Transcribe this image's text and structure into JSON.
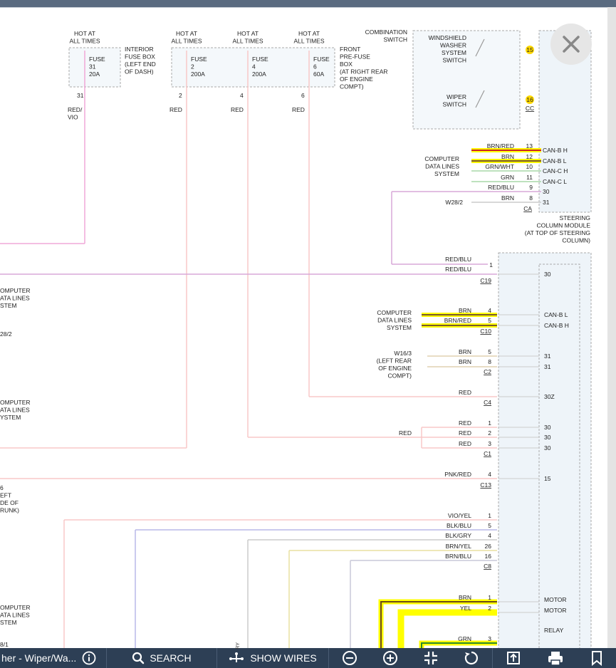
{
  "toolbar": {
    "title": "her - Wiper/Wa...",
    "search_label": "SEARCH",
    "show_wires_label": "SHOW WIRES",
    "vertical_stub": "RY"
  },
  "diagram": {
    "fuses": [
      {
        "hot": "HOT AT\nALL TIMES",
        "fuse": "FUSE\n31\n20A",
        "pin": "31",
        "wire": "RED/\nVIO"
      },
      {
        "hot": "HOT AT\nALL TIMES",
        "fuse": "FUSE\n2\n200A",
        "pin": "2",
        "wire": "RED"
      },
      {
        "hot": "HOT AT\nALL TIMES",
        "fuse": "FUSE\n4\n200A",
        "pin": "4",
        "wire": "RED"
      },
      {
        "hot": "HOT AT\nALL TIMES",
        "fuse": "FUSE\n6\n60A",
        "pin": "6",
        "wire": "RED"
      }
    ],
    "interior_fuse_box": "INTERIOR\nFUSE BOX\n(LEFT END\nOF DASH)",
    "front_prefuse_box": "FRONT\nPRE-FUSE\nBOX\n(AT RIGHT REAR\nOF ENGINE\nCOMPT)",
    "combination_switch": "COMBINATION\nSWITCH",
    "washer_switch": "WINDSHIELD\nWASHER\nSYSTEM\nSWITCH",
    "wiper_switch": "WIPER\nSWITCH",
    "badge_15": "15",
    "badge_16": "16",
    "cc_label": "CC",
    "computer_data_lines": "COMPUTER\nDATA LINES\nSYSTEM",
    "ca_wires": [
      {
        "color": "BRN/RED",
        "pin": "13",
        "signal": "CAN-B H"
      },
      {
        "color": "BRN",
        "pin": "12",
        "signal": "CAN-B L"
      },
      {
        "color": "GRN/WHT",
        "pin": "10",
        "signal": "CAN-C H"
      },
      {
        "color": "GRN",
        "pin": "11",
        "signal": "CAN-C L"
      },
      {
        "color": "RED/BLU",
        "pin": "9",
        "signal": "30"
      },
      {
        "color": "BRN",
        "pin": "8",
        "signal": "31"
      }
    ],
    "w28_2": "W28/2",
    "ca_label": "CA",
    "steering_column_module": "STEERING\nCOLUMN MODULE\n(AT TOP OF STEERING\nCOLUMN)",
    "c19": {
      "wire1": "RED/BLU",
      "wire2": "RED/BLU",
      "pin": "1",
      "conn": "C19",
      "signal": "30"
    },
    "c10": {
      "label": "COMPUTER\nDATA LINES\nSYSTEM",
      "w1": "BRN",
      "p1": "4",
      "w2": "BRN/RED",
      "p2": "5",
      "conn": "C10",
      "s1": "CAN-B L",
      "s2": "CAN-B H"
    },
    "c2": {
      "label": "W16/3\n(LEFT REAR\nOF ENGINE\nCOMPT)",
      "w1": "BRN",
      "p1": "5",
      "w2": "BRN",
      "p2": "8",
      "conn": "C2",
      "s1": "31",
      "s2": "31"
    },
    "c4": {
      "wire": "RED",
      "conn": "C4",
      "signal": "30Z"
    },
    "c1": {
      "input": "RED",
      "wires": [
        "RED",
        "RED",
        "RED"
      ],
      "pins": [
        "1",
        "2",
        "3"
      ],
      "conn": "C1",
      "signals": [
        "30",
        "30",
        "30"
      ]
    },
    "c13": {
      "wire": "PNK/RED",
      "pin": "4",
      "conn": "C13",
      "signal": "15"
    },
    "c8": {
      "wires": [
        "VIO/YEL",
        "BLK/BLU",
        "BLK/GRY",
        "BRN/YEL",
        "BRN/BLU"
      ],
      "pins": [
        "1",
        "5",
        "4",
        "26",
        "16"
      ],
      "conn": "C8"
    },
    "motor": [
      {
        "wire": "BRN",
        "pin": "1",
        "signal": "MOTOR"
      },
      {
        "wire": "YEL",
        "pin": "2",
        "signal": "MOTOR"
      },
      {
        "wire": "GRN",
        "pin": "3",
        "signal": "RELAY"
      }
    ],
    "left_labels": [
      "OMPUTER\nATA LINES\nSTEM",
      "28/2",
      "OMPUTER\nATA LINES\nYSTEM",
      "6\nEFT\nDE OF\nRUNK)",
      "OMPUTER\nATA LINES\nSTEM",
      "8/1"
    ]
  }
}
